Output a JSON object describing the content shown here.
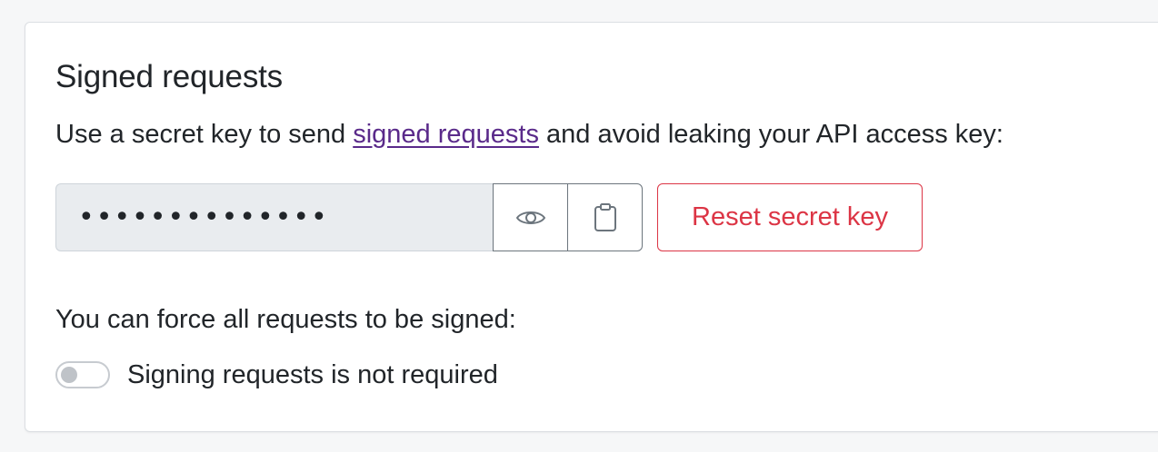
{
  "section": {
    "title": "Signed requests",
    "description_before": "Use a secret key to send ",
    "description_link": "signed requests",
    "description_after": " and avoid leaking your API access key:"
  },
  "secret_key": {
    "masked_value": "••••••••••••••",
    "show_icon": "eye-icon",
    "copy_icon": "clipboard-icon",
    "reset_label": "Reset secret key"
  },
  "force_signing": {
    "prompt": "You can force all requests to be signed:",
    "toggle_on": false,
    "toggle_label": "Signing requests is not required"
  },
  "colors": {
    "link": "#5a2a8a",
    "danger": "#dc3545",
    "field_bg": "#e9ecef"
  }
}
